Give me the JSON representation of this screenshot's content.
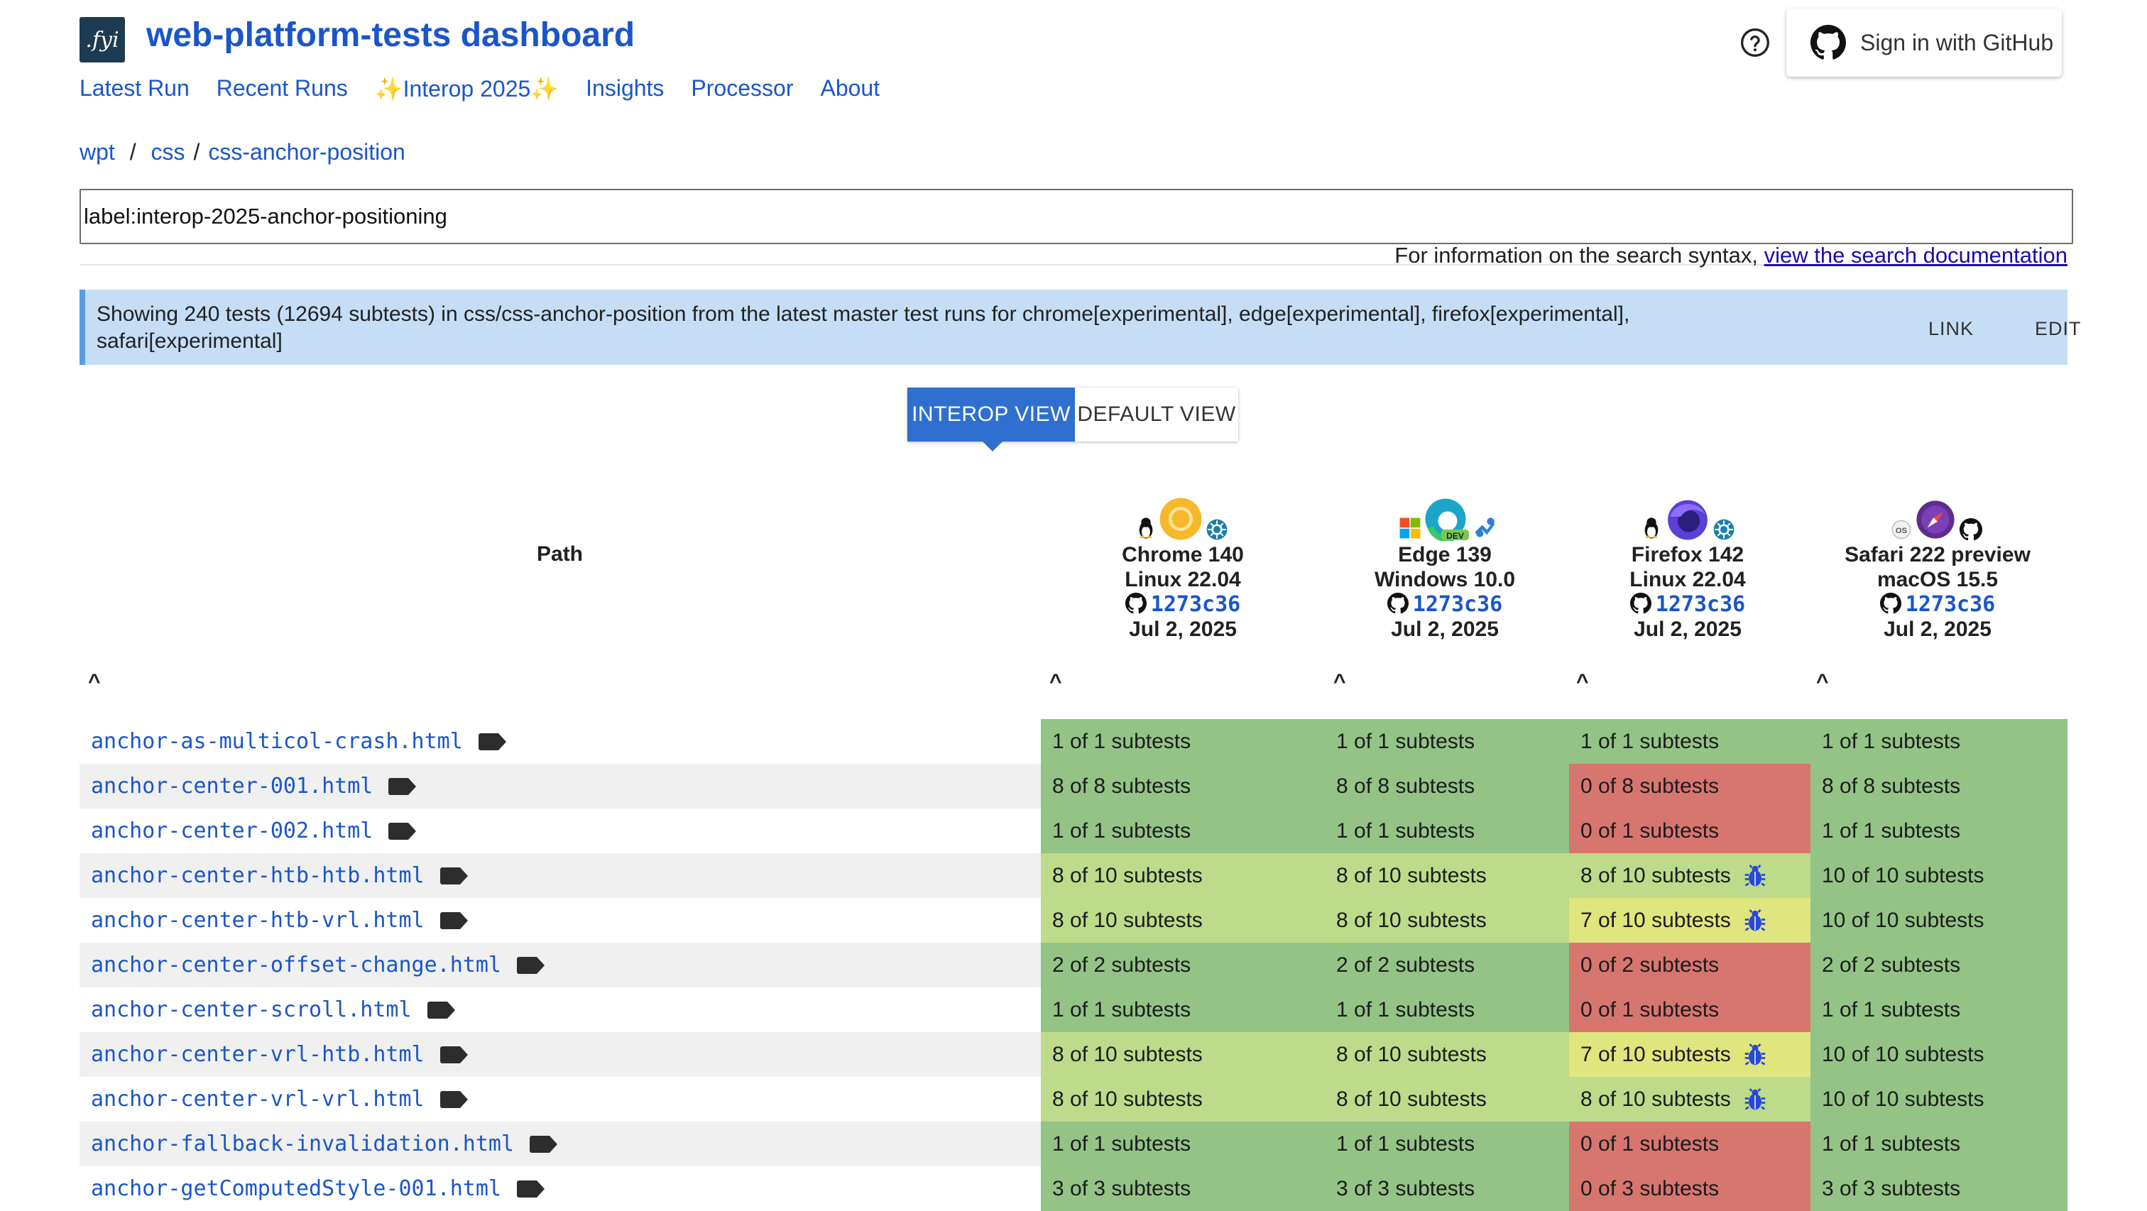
{
  "header": {
    "logo_text": ".fyi",
    "title": "web-platform-tests dashboard",
    "nav": [
      "Latest Run",
      "Recent Runs",
      "✨Interop 2025✨",
      "Insights",
      "Processor",
      "About"
    ],
    "signin_label": "Sign in with GitHub"
  },
  "breadcrumb": {
    "root": "wpt",
    "dir": "css",
    "leaf": "css-anchor-position"
  },
  "search": {
    "value": "label:interop-2025-anchor-positioning",
    "help_prefix": "For information on the search syntax,",
    "help_link": "view the search documentation"
  },
  "banner": {
    "text": "Showing 240 tests (12694 subtests) in css/css-anchor-position from the latest master test runs for chrome[experimental], edge[experimental], firefox[experimental], safari[experimental]",
    "link_label": "LINK",
    "edit_label": "EDIT"
  },
  "views": {
    "interop": "INTEROP VIEW",
    "default": "DEFAULT VIEW"
  },
  "table": {
    "path_header": "Path",
    "sort_glyph": "^",
    "browsers": [
      {
        "name": "Chrome 140",
        "os": "Linux 22.04",
        "sha": "1273c36",
        "date": "Jul 2, 2025"
      },
      {
        "name": "Edge 139",
        "os": "Windows 10.0",
        "sha": "1273c36",
        "date": "Jul 2, 2025"
      },
      {
        "name": "Firefox 142",
        "os": "Linux 22.04",
        "sha": "1273c36",
        "date": "Jul 2, 2025"
      },
      {
        "name": "Safari 222 preview",
        "os": "macOS 15.5",
        "sha": "1273c36",
        "date": "Jul 2, 2025"
      }
    ],
    "rows": [
      {
        "path": "anchor-as-multicol-crash.html",
        "chrome": "1 of 1 subtests",
        "edge": "1 of 1 subtests",
        "firefox": "1 of 1 subtests",
        "safari": "1 of 1 subtests"
      },
      {
        "path": "anchor-center-001.html",
        "chrome": "8 of 8 subtests",
        "edge": "8 of 8 subtests",
        "firefox": "0 of 8 subtests",
        "safari": "8 of 8 subtests"
      },
      {
        "path": "anchor-center-002.html",
        "chrome": "1 of 1 subtests",
        "edge": "1 of 1 subtests",
        "firefox": "0 of 1 subtests",
        "safari": "1 of 1 subtests"
      },
      {
        "path": "anchor-center-htb-htb.html",
        "chrome": "8 of 10 subtests",
        "edge": "8 of 10 subtests",
        "firefox": "8 of 10 subtests",
        "safari": "10 of 10 subtests"
      },
      {
        "path": "anchor-center-htb-vrl.html",
        "chrome": "8 of 10 subtests",
        "edge": "8 of 10 subtests",
        "firefox": "7 of 10 subtests",
        "safari": "10 of 10 subtests"
      },
      {
        "path": "anchor-center-offset-change.html",
        "chrome": "2 of 2 subtests",
        "edge": "2 of 2 subtests",
        "firefox": "0 of 2 subtests",
        "safari": "2 of 2 subtests"
      },
      {
        "path": "anchor-center-scroll.html",
        "chrome": "1 of 1 subtests",
        "edge": "1 of 1 subtests",
        "firefox": "0 of 1 subtests",
        "safari": "1 of 1 subtests"
      },
      {
        "path": "anchor-center-vrl-htb.html",
        "chrome": "8 of 10 subtests",
        "edge": "8 of 10 subtests",
        "firefox": "7 of 10 subtests",
        "safari": "10 of 10 subtests"
      },
      {
        "path": "anchor-center-vrl-vrl.html",
        "chrome": "8 of 10 subtests",
        "edge": "8 of 10 subtests",
        "firefox": "8 of 10 subtests",
        "safari": "10 of 10 subtests"
      },
      {
        "path": "anchor-fallback-invalidation.html",
        "chrome": "1 of 1 subtests",
        "edge": "1 of 1 subtests",
        "firefox": "0 of 1 subtests",
        "safari": "1 of 1 subtests"
      },
      {
        "path": "anchor-getComputedStyle-001.html",
        "chrome": "3 of 3 subtests",
        "edge": "3 of 3 subtests",
        "firefox": "0 of 3 subtests",
        "safari": "3 of 3 subtests"
      }
    ]
  },
  "colors": {
    "pass": "#93c486",
    "partial": "#bddb8b",
    "mostly_fail": "#e0e67e",
    "fail": "#d6766f",
    "link": "#1a56c9",
    "bug_icon": "#2948d8"
  }
}
